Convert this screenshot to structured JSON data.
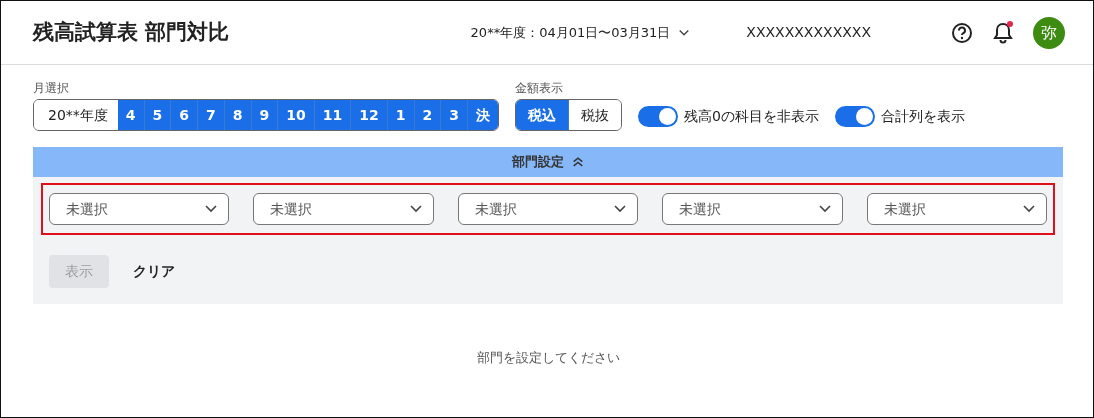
{
  "header": {
    "title": "残高試算表 部門対比",
    "period": "20**年度：04月01日〜03月31日",
    "account": "XXXXXXXXXXXXX",
    "avatar": "弥",
    "has_notification": true
  },
  "month_selector": {
    "label": "月選択",
    "items": [
      {
        "label": "20**年度",
        "selected": false
      },
      {
        "label": "4",
        "selected": true
      },
      {
        "label": "5",
        "selected": true
      },
      {
        "label": "6",
        "selected": true
      },
      {
        "label": "7",
        "selected": true
      },
      {
        "label": "8",
        "selected": true
      },
      {
        "label": "9",
        "selected": true
      },
      {
        "label": "10",
        "selected": true
      },
      {
        "label": "11",
        "selected": true
      },
      {
        "label": "12",
        "selected": true
      },
      {
        "label": "1",
        "selected": true
      },
      {
        "label": "2",
        "selected": true
      },
      {
        "label": "3",
        "selected": true
      },
      {
        "label": "決",
        "selected": true
      }
    ]
  },
  "amount_display": {
    "label": "金額表示",
    "options": [
      {
        "label": "税込",
        "selected": true
      },
      {
        "label": "税抜",
        "selected": false
      }
    ]
  },
  "toggles": [
    {
      "label": "残高0の科目を非表示",
      "on": true
    },
    {
      "label": "合計列を表示",
      "on": true
    }
  ],
  "department_settings": {
    "title": "部門設定",
    "expanded": true,
    "highlighted": true,
    "selects": [
      {
        "value": "未選択"
      },
      {
        "value": "未選択"
      },
      {
        "value": "未選択"
      },
      {
        "value": "未選択"
      },
      {
        "value": "未選択"
      }
    ],
    "buttons": [
      {
        "label": "表示",
        "kind": "primary",
        "disabled": true
      },
      {
        "label": "クリア",
        "kind": "link",
        "disabled": false
      }
    ]
  },
  "message": "部門を設定してください"
}
